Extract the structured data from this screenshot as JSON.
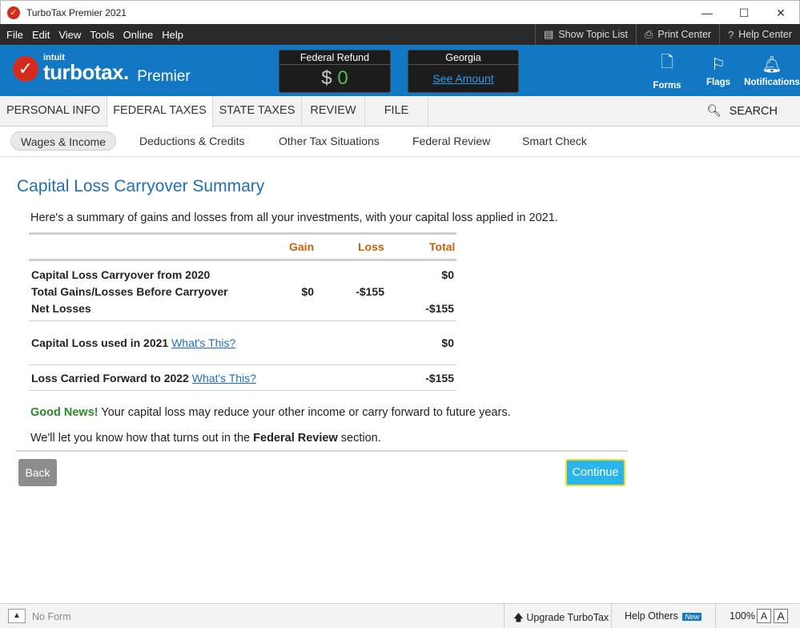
{
  "window": {
    "title": "TurboTax Premier 2021"
  },
  "menu": {
    "items": [
      "File",
      "Edit",
      "View",
      "Tools",
      "Online",
      "Help"
    ],
    "tools": [
      "Show Topic List",
      "Print Center",
      "Help Center"
    ]
  },
  "header": {
    "intuit": "intuit",
    "brand": "turbotax.",
    "edition": "Premier",
    "federal_refund": {
      "label": "Federal Refund",
      "currency": "$",
      "value": "0"
    },
    "state_refund": {
      "label": "Georgia",
      "link": "See Amount"
    },
    "icons": [
      "Forms",
      "Flags",
      "Notifications"
    ]
  },
  "main_tabs": [
    "PERSONAL INFO",
    "FEDERAL TAXES",
    "STATE TAXES",
    "REVIEW",
    "FILE"
  ],
  "search_label": "SEARCH",
  "sub_tabs": [
    "Wages & Income",
    "Deductions & Credits",
    "Other Tax Situations",
    "Federal Review",
    "Smart Check"
  ],
  "content": {
    "title": "Capital Loss Carryover Summary",
    "intro": "Here's a summary of gains and losses from all your investments, with your capital loss applied in 2021.",
    "table": {
      "headers": [
        "Gain",
        "Loss",
        "Total"
      ],
      "rows": [
        {
          "label": "Capital Loss Carryover from 2020",
          "gain": "",
          "loss": "",
          "total": "$0"
        },
        {
          "label": "Total Gains/Losses Before Carryover",
          "gain": "$0",
          "loss": "-$155",
          "total": ""
        },
        {
          "label": "Net Losses",
          "gain": "",
          "loss": "",
          "total": "-$155"
        },
        {
          "label": "Capital Loss used in 2021",
          "link": "What's This?",
          "total": "$0"
        },
        {
          "label": "Loss Carried Forward to 2022",
          "link": "What's This?",
          "total": "-$155"
        }
      ]
    },
    "good_news_label": "Good News!",
    "good_news_text": "Your capital loss may reduce your other income or carry forward to future years.",
    "review_prefix": "We'll let you know how that turns out in the",
    "review_bold": "Federal Review",
    "review_suffix": "section.",
    "back_label": "Back",
    "continue_label": "Continue"
  },
  "statusbar": {
    "no_form": "No Form",
    "upgrade": "Upgrade TurboTax",
    "help_others": "Help Others",
    "new_badge": "New",
    "zoom": "100%",
    "font_small": "A",
    "font_large": "A"
  },
  "colors": {
    "brand_blue": "#1378c4",
    "title_blue": "#1f6fb5",
    "header_orange": "#c8620a",
    "good_news_green": "#2a8a2a",
    "continue_blue": "#2ab4ec"
  }
}
